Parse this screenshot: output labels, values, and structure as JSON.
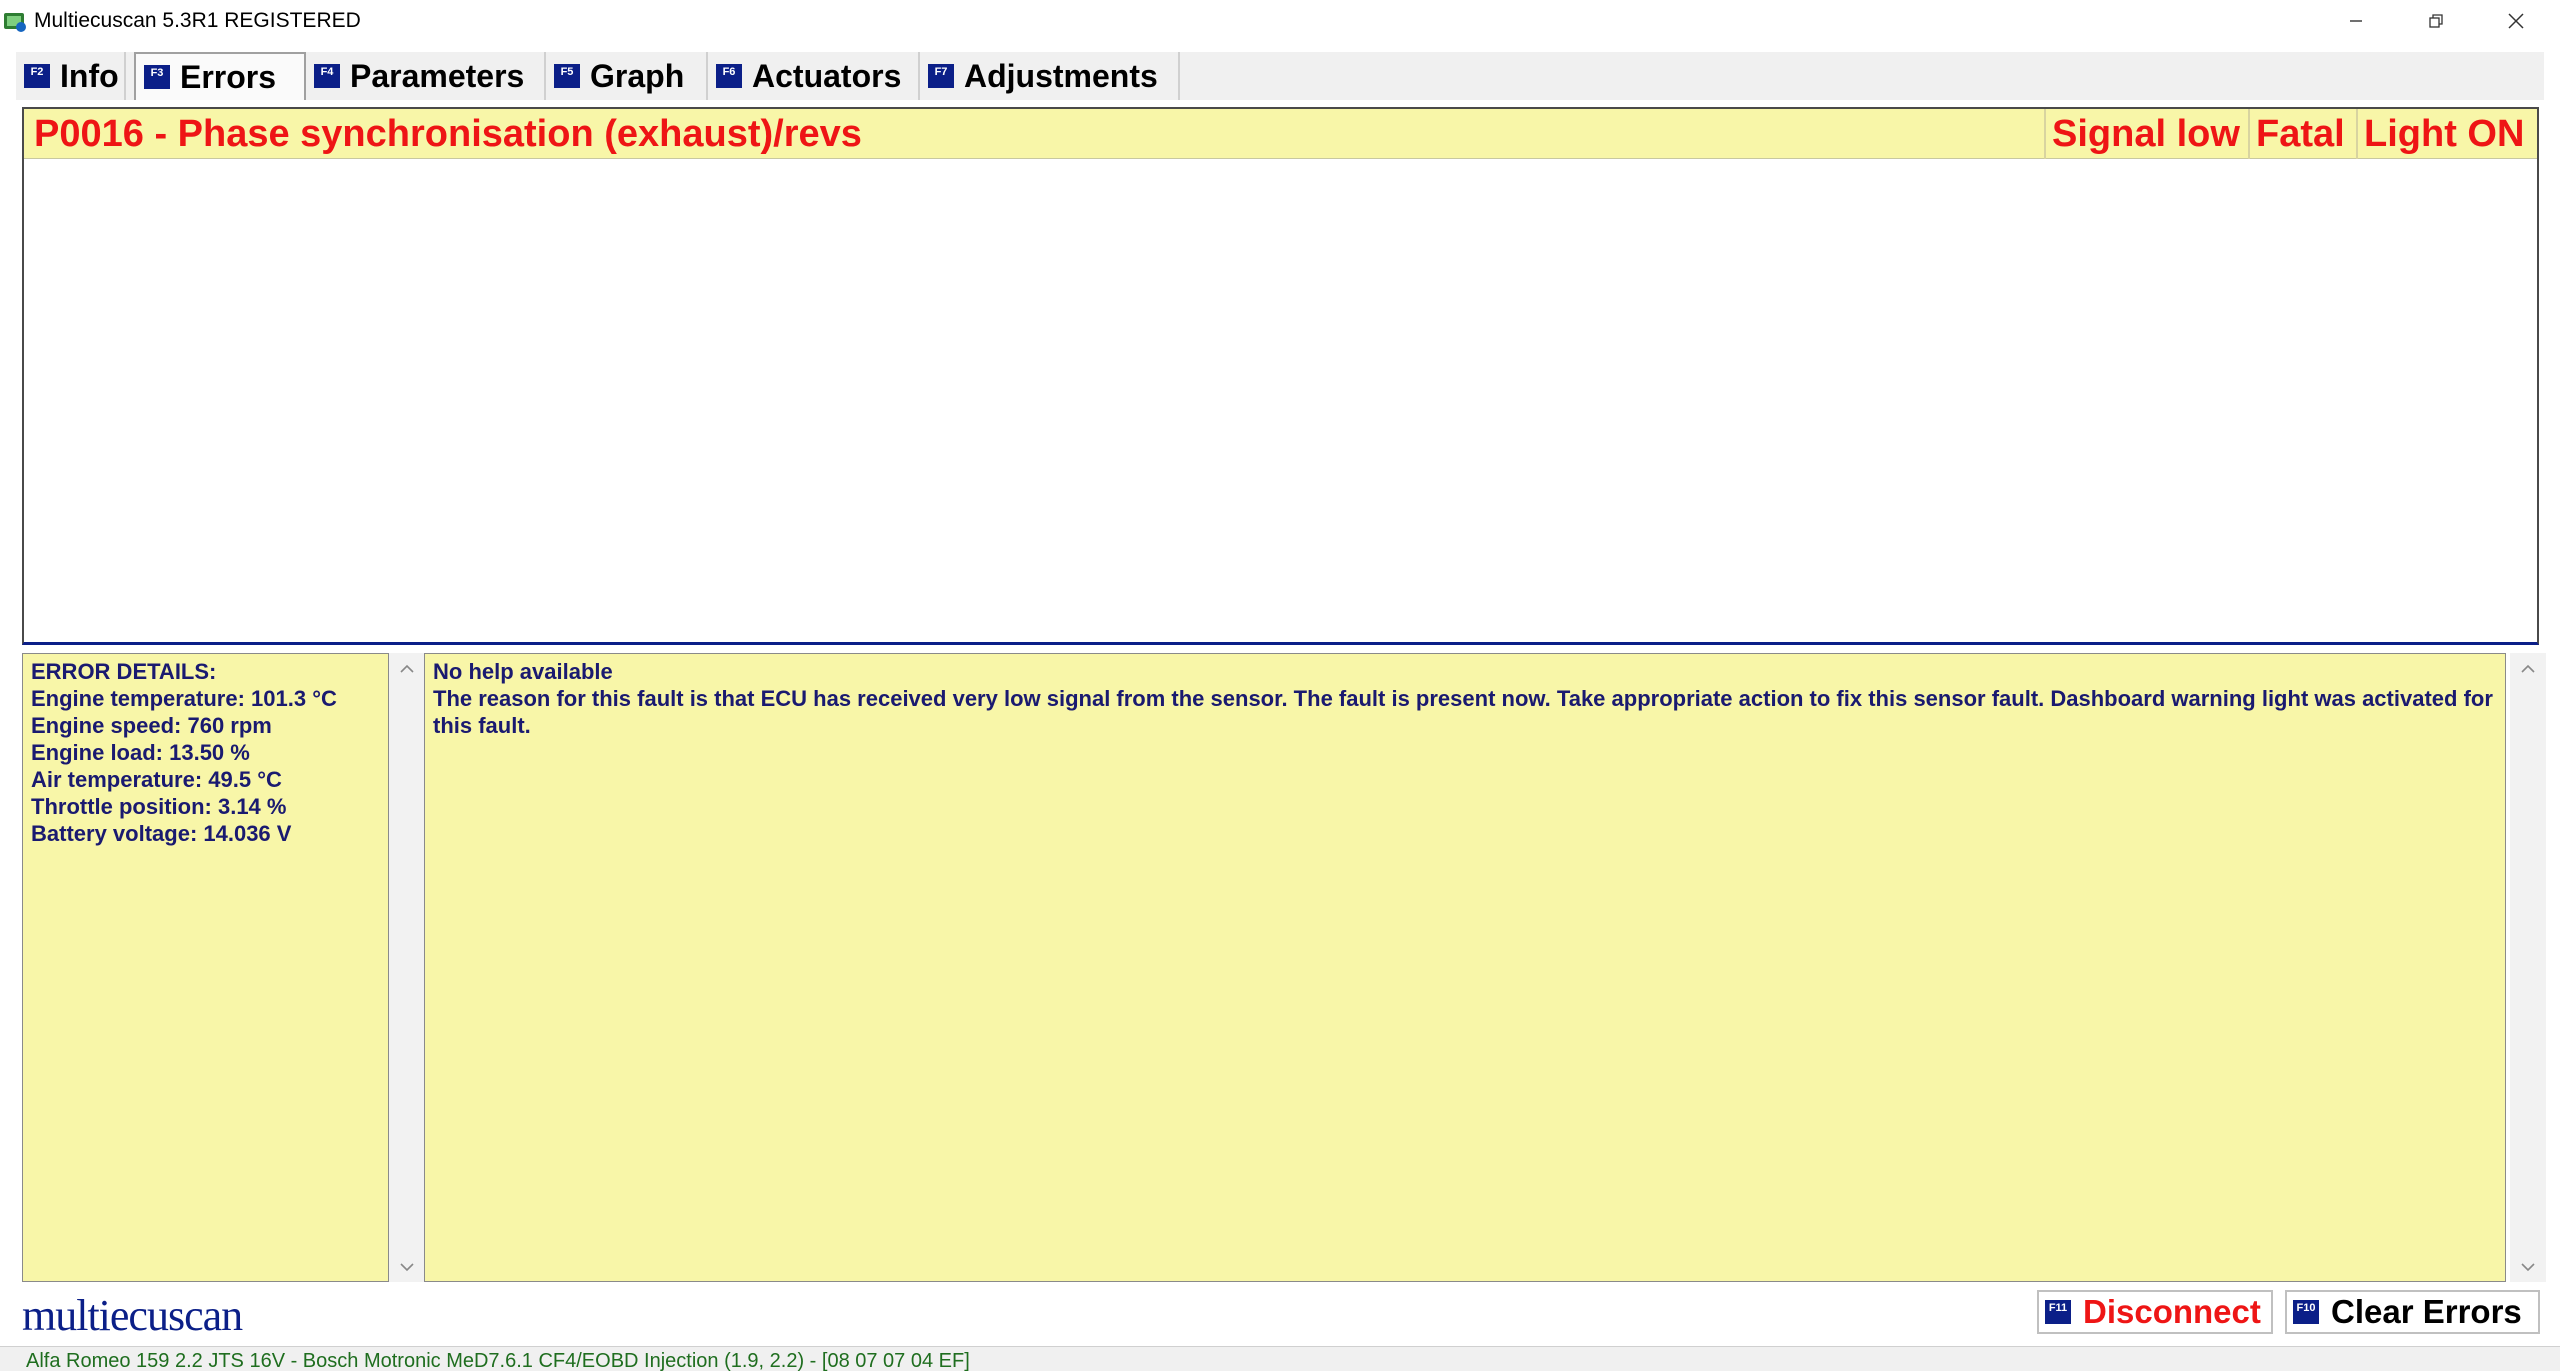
{
  "window": {
    "title": "Multiecuscan 5.3R1 REGISTERED"
  },
  "tabs": [
    {
      "key": "F2",
      "label": "Info"
    },
    {
      "key": "F3",
      "label": "Errors"
    },
    {
      "key": "F4",
      "label": "Parameters"
    },
    {
      "key": "F5",
      "label": "Graph"
    },
    {
      "key": "F6",
      "label": "Actuators"
    },
    {
      "key": "F7",
      "label": "Adjustments"
    }
  ],
  "active_tab": "Errors",
  "errors": [
    {
      "code_description": "P0016 - Phase synchronisation (exhaust)/revs",
      "condition": "Signal low",
      "severity": "Fatal",
      "light": "Light ON"
    }
  ],
  "details": {
    "title": "ERROR DETAILS:",
    "lines": [
      "Engine temperature: 101.3 °C",
      "Engine speed: 760 rpm",
      "Engine load: 13.50 %",
      "Air temperature: 49.5 °C",
      "Throttle position: 3.14 %",
      "Battery voltage: 14.036 V"
    ]
  },
  "help": {
    "title": "No help available",
    "body": "The reason for this fault is that ECU has received very low signal from the sensor. The fault is present now. Take appropriate action to fix this sensor fault. Dashboard warning light was activated for this fault."
  },
  "footer": {
    "logo": "multiecuscan",
    "disconnect": {
      "key": "F11",
      "label": "Disconnect"
    },
    "clear_errors": {
      "key": "F10",
      "label": "Clear Errors"
    }
  },
  "status": {
    "text": "Alfa Romeo 159 2.2 JTS 16V - Bosch Motronic MeD7.6.1 CF4/EOBD Injection (1.9, 2.2) - [08 07 07 04 EF]"
  },
  "colors": {
    "accent_blue": "#0b1f88",
    "error_red": "#ee1515",
    "panel_yellow": "#f8f6a8",
    "panel_text": "#1a1a70",
    "status_green": "#1f6e1f"
  }
}
